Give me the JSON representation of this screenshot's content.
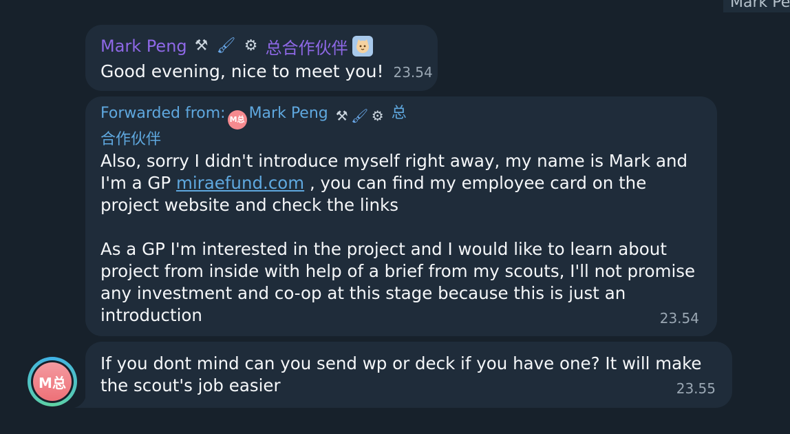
{
  "top_label": "Mark Pe",
  "messages": [
    {
      "sender": "Mark Peng",
      "sender_title": "总合作伙伴",
      "icons": [
        "hammer-wrench-icon",
        "paintbrush-icon",
        "gear-icon",
        "cat-sticker-icon"
      ],
      "text": "Good evening, nice to meet you!",
      "time": "23.54"
    },
    {
      "forwarded_label": "Forwarded from:",
      "forwarded_name": "Mark Peng",
      "forwarded_title_a": "总",
      "forwarded_title_b": "合作伙伴",
      "mini_avatar": "M总",
      "para1_a": "Also, sorry I didn't introduce myself right away, my name is Mark and I'm a GP ",
      "para1_link": "miraefund.com",
      "para1_b": " , you can find my employee card on the project website and check the links",
      "para2": "As a GP I'm interested in the project and I would like to learn about project from inside with help of a brief from my scouts, I'll not promise any investment and co-op at this stage because this is just an introduction",
      "time": "23.54"
    },
    {
      "text": "If you dont mind can you send wp or deck if you have one? It will make the scout's job easier",
      "time": "23.55"
    }
  ],
  "avatar": {
    "initials": "M总",
    "color": "#ee7178"
  },
  "colors": {
    "background": "#17212b",
    "bubble": "#1f2c3a",
    "sender_name": "#8e68e6",
    "link": "#5fa8df",
    "time": "#9aa7b3"
  }
}
